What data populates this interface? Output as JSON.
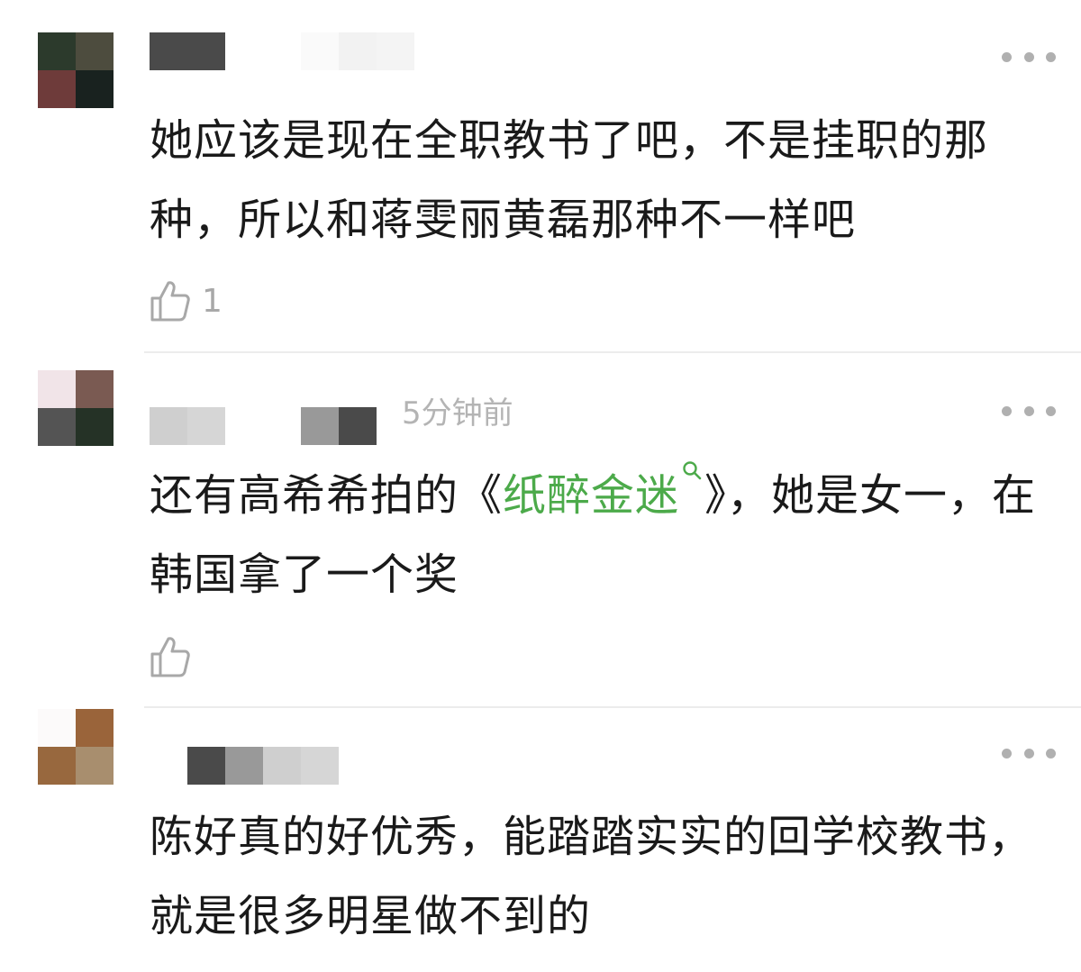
{
  "colors": {
    "text": "#1a1a1a",
    "muted": "#b4b4b4",
    "link": "#4caa4a",
    "divider": "#ececec"
  },
  "comments": [
    {
      "username": "",
      "time": "",
      "text_before": "她应该是现在全职教书了吧，不是挂职的那种，所以和蒋雯丽黄磊那种不一样吧",
      "link_text": "",
      "text_after": "",
      "like_icon": "thumbs-up-icon",
      "likes": "1",
      "more_icon": "more-dots-icon"
    },
    {
      "username": "",
      "time": "5分钟前",
      "text_before": "还有高希希拍的《",
      "link_text": "纸醉金迷",
      "text_after": "》，她是女一，在韩国拿了一个奖",
      "link_icon": "search-icon",
      "like_icon": "thumbs-up-icon",
      "likes": "",
      "more_icon": "more-dots-icon"
    },
    {
      "username": "",
      "time": "",
      "text_before": "陈好真的好优秀，能踏踏实实的回学校教书，就是很多明星做不到的",
      "link_text": "",
      "text_after": "",
      "more_icon": "more-dots-icon"
    }
  ]
}
